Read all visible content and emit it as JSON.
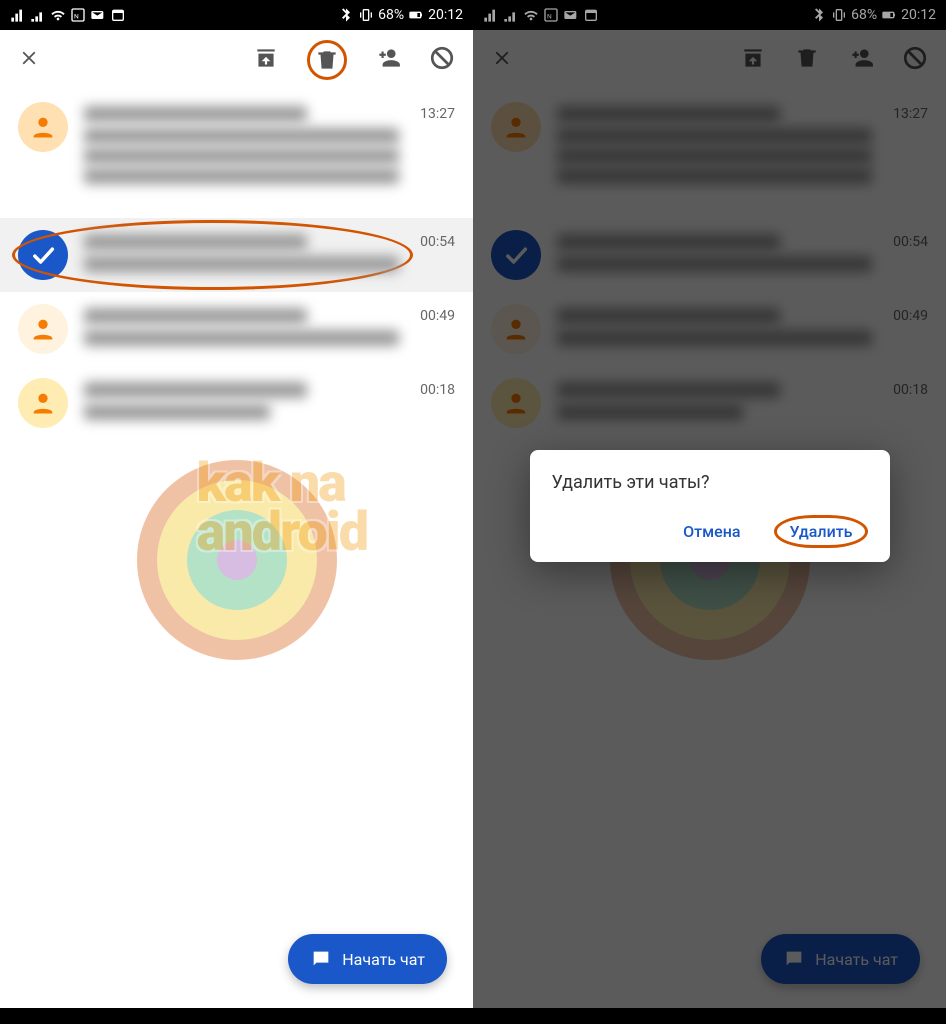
{
  "status_bar": {
    "battery_pct": "68%",
    "time": "20:12"
  },
  "app_bar": {
    "close": "close",
    "archive": "archive",
    "delete": "delete",
    "add_contact": "add_contact",
    "block": "block"
  },
  "chats": [
    {
      "time": "13:27",
      "selected": false,
      "avatar": "orange",
      "tall": true
    },
    {
      "time": "00:54",
      "selected": true,
      "avatar": "blue"
    },
    {
      "time": "00:49",
      "selected": false,
      "avatar": "amber"
    },
    {
      "time": "00:18",
      "selected": false,
      "avatar": "amber2"
    }
  ],
  "fab_label": "Начать чат",
  "dialog": {
    "title": "Удалить эти чаты?",
    "cancel": "Отмена",
    "confirm": "Удалить"
  }
}
